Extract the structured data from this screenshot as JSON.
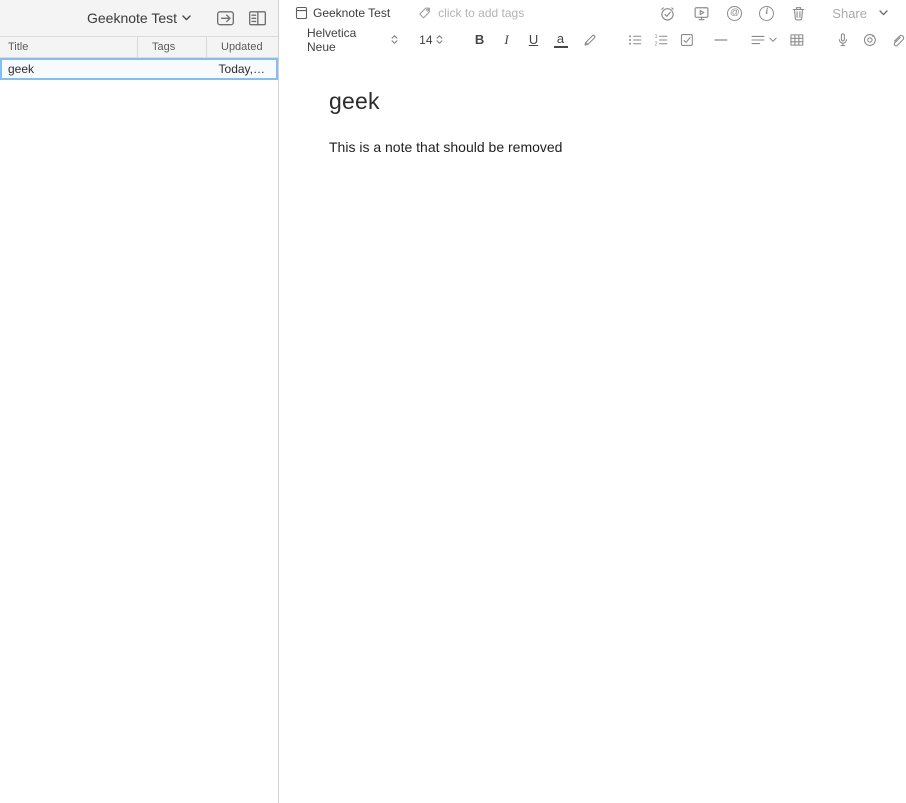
{
  "colors": {
    "selection_border": "#84c0ee",
    "selection_background": "#f7fbff",
    "icon_gray": "#8b8b8b",
    "panel_header_background": "#f5f4f4"
  },
  "sidebar": {
    "title": "Geeknote Test",
    "header_icons": [
      "new-note-icon",
      "toggle-view-icon"
    ],
    "columns": {
      "title": "Title",
      "tags": "Tags",
      "updated": "Updated"
    },
    "rows": [
      {
        "title": "geek",
        "tags": "",
        "updated": "Today,…",
        "selected": true
      }
    ]
  },
  "editor": {
    "topbar": {
      "notebook_label": "Geeknote Test",
      "tags_placeholder": "click to add tags",
      "action_icons": [
        "reminder-icon",
        "present-icon",
        "at-mention-icon",
        "info-icon",
        "trash-icon"
      ],
      "share_label": "Share"
    },
    "toolbar": {
      "font_name": "Helvetica Neue",
      "font_size": "14",
      "bold_label": "B",
      "italic_label": "I",
      "underline_label": "U",
      "color_label": "a",
      "icons": [
        "highlighter-icon",
        "bullet-list-icon",
        "numbered-list-icon",
        "checkbox-icon",
        "horizontal-rule-icon",
        "align-icon",
        "table-icon",
        "microphone-icon",
        "camera-icon",
        "attachment-icon"
      ]
    },
    "note": {
      "title": "geek",
      "body": "This is a note that should be removed"
    }
  }
}
